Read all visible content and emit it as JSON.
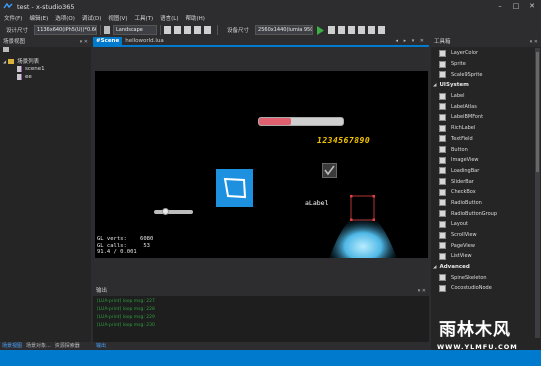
{
  "window": {
    "title": "test - x-studio365",
    "controls": [
      "–",
      "□",
      "✕"
    ]
  },
  "menu": [
    "文件(F)",
    "编辑(E)",
    "选项(O)",
    "调试(D)",
    "视图(V)",
    "工具(T)",
    "语言(L)",
    "帮助(H)"
  ],
  "toolbar": {
    "design_size_label": "设计尺寸",
    "design_size_value": "1136x640(iPh5(U))*0.66",
    "orientation_value": "Landscape",
    "device_size_label": "设备尺寸",
    "device_size_value": "2560x1440(lumia 950XL"
  },
  "left_panel": {
    "title": "场景视图",
    "tree_root": "场景列表",
    "items": [
      "scene1",
      "ee"
    ],
    "bottom_tabs": [
      "场景视图",
      "场景对象...",
      "资源探索器"
    ]
  },
  "tabs": {
    "scene": "#Scene",
    "file": "helloworld.lua"
  },
  "scene": {
    "number_label": "1234567890",
    "text_label": "aLabel",
    "progress_fraction": 0.38,
    "slider_fraction": 0.2,
    "stats": "GL verts:    6080\nGL calls:     53\n91.4 / 0.001"
  },
  "output": {
    "title": "输出",
    "lines": [
      "[LUA-print] loop msg: 227",
      "[LUA-print] loop msg: 228",
      "[LUA-print] loop msg: 229",
      "[LUA-print] loop msg: 230"
    ],
    "tab": "输出"
  },
  "right_panel": {
    "title": "工具箱",
    "items_top": [
      "LayerColor",
      "Sprite",
      "Scale9Sprite"
    ],
    "category_ui": "UISystem",
    "items_ui": [
      "Label",
      "LabelAtlas",
      "LabelBMFont",
      "RichLabel",
      "TextField",
      "Button",
      "ImageView",
      "LoadingBar",
      "SliderBar",
      "CheckBox",
      "RadioButton",
      "RadioButtonGroup",
      "Layout",
      "ScrollView",
      "PageView",
      "ListView"
    ],
    "category_adv": "Advanced",
    "items_adv": [
      "SpineSkeleton",
      "CocostudioNode"
    ]
  },
  "watermark": {
    "text": "雨林木风",
    "url": "WWW.YLMFU.COM"
  },
  "colors": {
    "accent": "#007acc",
    "progress_fill": "#e06070",
    "number_label": "#f5c400",
    "image_tile": "#1e90e0"
  }
}
